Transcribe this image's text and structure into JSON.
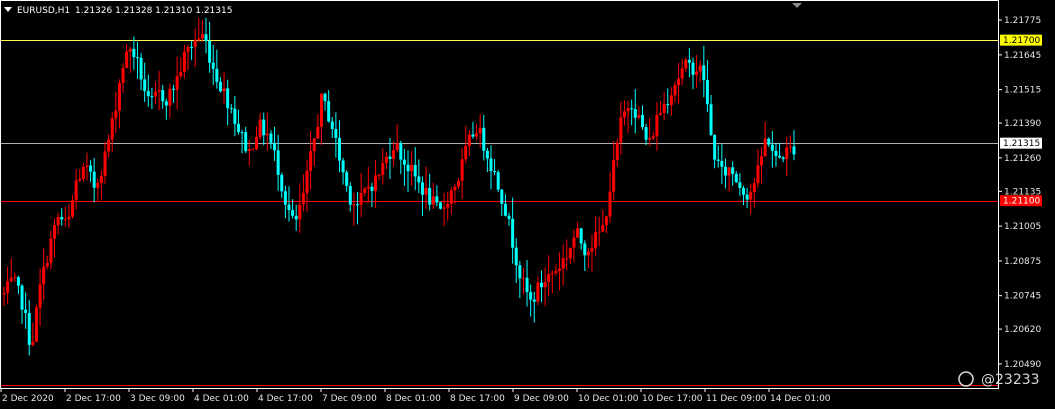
{
  "header": {
    "symbol": "EURUSD,H1",
    "ohlc": "1.21326 1.21328 1.21310 1.21315"
  },
  "watermark": {
    "text": "@23233"
  },
  "colors": {
    "background": "#000000",
    "frame": "#ffffff",
    "bull": "#ff0000",
    "bear": "#00ffff",
    "bid_line": "#b0b0b0",
    "resistance_line": "#ffff55",
    "support_line": "#ff0000",
    "bottom_line": "#ff0000",
    "resistance_tag": "#ffff00",
    "support_tag": "#ff0000",
    "bid_tag": "#ffffff"
  },
  "chart_data": {
    "type": "candlestick",
    "title": "EURUSD,H1",
    "ylim": [
      1.204,
      1.2185
    ],
    "y_ticks": [
      "1.21775",
      "1.21645",
      "1.21515",
      "1.21390",
      "1.21260",
      "1.21135",
      "1.21005",
      "1.20875",
      "1.20745",
      "1.20620",
      "1.20490"
    ],
    "x_ticks": [
      "2 Dec 2020",
      "2 Dec 17:00",
      "3 Dec 09:00",
      "4 Dec 01:00",
      "4 Dec 17:00",
      "7 Dec 09:00",
      "8 Dec 01:00",
      "8 Dec 17:00",
      "9 Dec 09:00",
      "10 Dec 01:00",
      "10 Dec 17:00",
      "11 Dec 09:00",
      "14 Dec 01:00"
    ],
    "horizontal_levels": [
      {
        "value": 1.217,
        "label": "1.21700",
        "color": "#ffff55"
      },
      {
        "value": 1.21315,
        "label": "1.21315",
        "color": "#b0b0b0"
      },
      {
        "value": 1.211,
        "label": "1.21100",
        "color": "#ff0000"
      },
      {
        "value": 1.2041,
        "label": "",
        "color": "#ff0000"
      }
    ],
    "path": [
      [
        1.2075,
        0
      ],
      [
        1.208,
        1
      ],
      [
        1.2072,
        2
      ],
      [
        1.2055,
        1
      ],
      [
        1.2078,
        0
      ],
      [
        1.2093,
        0
      ],
      [
        1.2104,
        0
      ],
      [
        1.21,
        1
      ],
      [
        1.2118,
        0
      ],
      [
        1.2122,
        1
      ],
      [
        1.2115,
        1
      ],
      [
        1.2125,
        0
      ],
      [
        1.214,
        0
      ],
      [
        1.216,
        0
      ],
      [
        1.2168,
        0
      ],
      [
        1.2158,
        1
      ],
      [
        1.2145,
        1
      ],
      [
        1.215,
        0
      ],
      [
        1.2148,
        1
      ],
      [
        1.2155,
        0
      ],
      [
        1.2165,
        0
      ],
      [
        1.217,
        0
      ],
      [
        1.2172,
        0
      ],
      [
        1.216,
        1
      ],
      [
        1.2152,
        1
      ],
      [
        1.2145,
        1
      ],
      [
        1.2135,
        1
      ],
      [
        1.2128,
        1
      ],
      [
        1.2138,
        0
      ],
      [
        1.2135,
        1
      ],
      [
        1.2125,
        1
      ],
      [
        1.211,
        1
      ],
      [
        1.21,
        1
      ],
      [
        1.2112,
        0
      ],
      [
        1.213,
        0
      ],
      [
        1.2148,
        0
      ],
      [
        1.214,
        1
      ],
      [
        1.2125,
        1
      ],
      [
        1.2112,
        1
      ],
      [
        1.2108,
        1
      ],
      [
        1.2115,
        0
      ],
      [
        1.2118,
        0
      ],
      [
        1.2125,
        0
      ],
      [
        1.2132,
        0
      ],
      [
        1.2125,
        1
      ],
      [
        1.212,
        1
      ],
      [
        1.2115,
        1
      ],
      [
        1.211,
        1
      ],
      [
        1.2105,
        1
      ],
      [
        1.2112,
        0
      ],
      [
        1.2118,
        0
      ],
      [
        1.213,
        0
      ],
      [
        1.2138,
        0
      ],
      [
        1.213,
        1
      ],
      [
        1.212,
        1
      ],
      [
        1.211,
        1
      ],
      [
        1.2095,
        1
      ],
      [
        1.208,
        1
      ],
      [
        1.2072,
        1
      ],
      [
        1.2078,
        0
      ],
      [
        1.2082,
        0
      ],
      [
        1.2085,
        0
      ],
      [
        1.209,
        0
      ],
      [
        1.2098,
        0
      ],
      [
        1.2092,
        1
      ],
      [
        1.2095,
        0
      ],
      [
        1.21,
        0
      ],
      [
        1.212,
        0
      ],
      [
        1.214,
        0
      ],
      [
        1.2148,
        0
      ],
      [
        1.214,
        1
      ],
      [
        1.213,
        1
      ],
      [
        1.2142,
        0
      ],
      [
        1.2148,
        0
      ],
      [
        1.2155,
        0
      ],
      [
        1.216,
        0
      ],
      [
        1.216,
        1
      ],
      [
        1.2158,
        1
      ],
      [
        1.213,
        1
      ],
      [
        1.212,
        1
      ],
      [
        1.2122,
        0
      ],
      [
        1.2116,
        1
      ],
      [
        1.2112,
        1
      ],
      [
        1.212,
        0
      ],
      [
        1.2135,
        0
      ],
      [
        1.2125,
        1
      ],
      [
        1.2128,
        0
      ],
      [
        1.213,
        0
      ]
    ]
  }
}
